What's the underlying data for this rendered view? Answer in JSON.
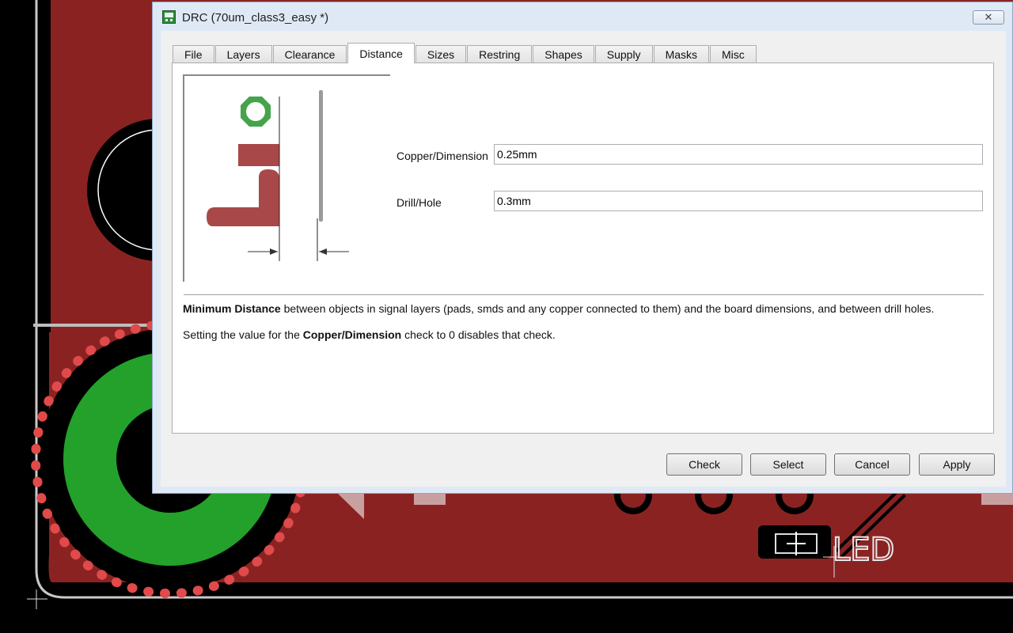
{
  "window": {
    "title": "DRC (70um_class3_easy *)",
    "close_symbol": "✕"
  },
  "tabs": [
    {
      "label": "File"
    },
    {
      "label": "Layers"
    },
    {
      "label": "Clearance"
    },
    {
      "label": "Distance",
      "active": true
    },
    {
      "label": "Sizes"
    },
    {
      "label": "Restring"
    },
    {
      "label": "Shapes"
    },
    {
      "label": "Supply"
    },
    {
      "label": "Masks"
    },
    {
      "label": "Misc"
    }
  ],
  "fields": {
    "copper_dimension": {
      "label": "Copper/Dimension",
      "value": "0.25mm"
    },
    "drill_hole": {
      "label": "Drill/Hole",
      "value": "0.3mm"
    }
  },
  "description": {
    "line1_bold": "Minimum Distance",
    "line1_rest": " between objects in signal layers (pads, smds and any copper connected to them) and the board dimensions, and between drill holes.",
    "line2_pre": "Setting the value for the ",
    "line2_bold": "Copper/Dimension",
    "line2_post": " check to 0 disables that check."
  },
  "buttons": {
    "check": "Check",
    "select": "Select",
    "cancel": "Cancel",
    "apply": "Apply"
  },
  "board": {
    "part_label": "LED"
  },
  "colors": {
    "board_red": "#8b2222",
    "pad_green": "#1f9a2a",
    "copper_red": "#a84848",
    "dialog_bg": "#f0f0f0"
  }
}
